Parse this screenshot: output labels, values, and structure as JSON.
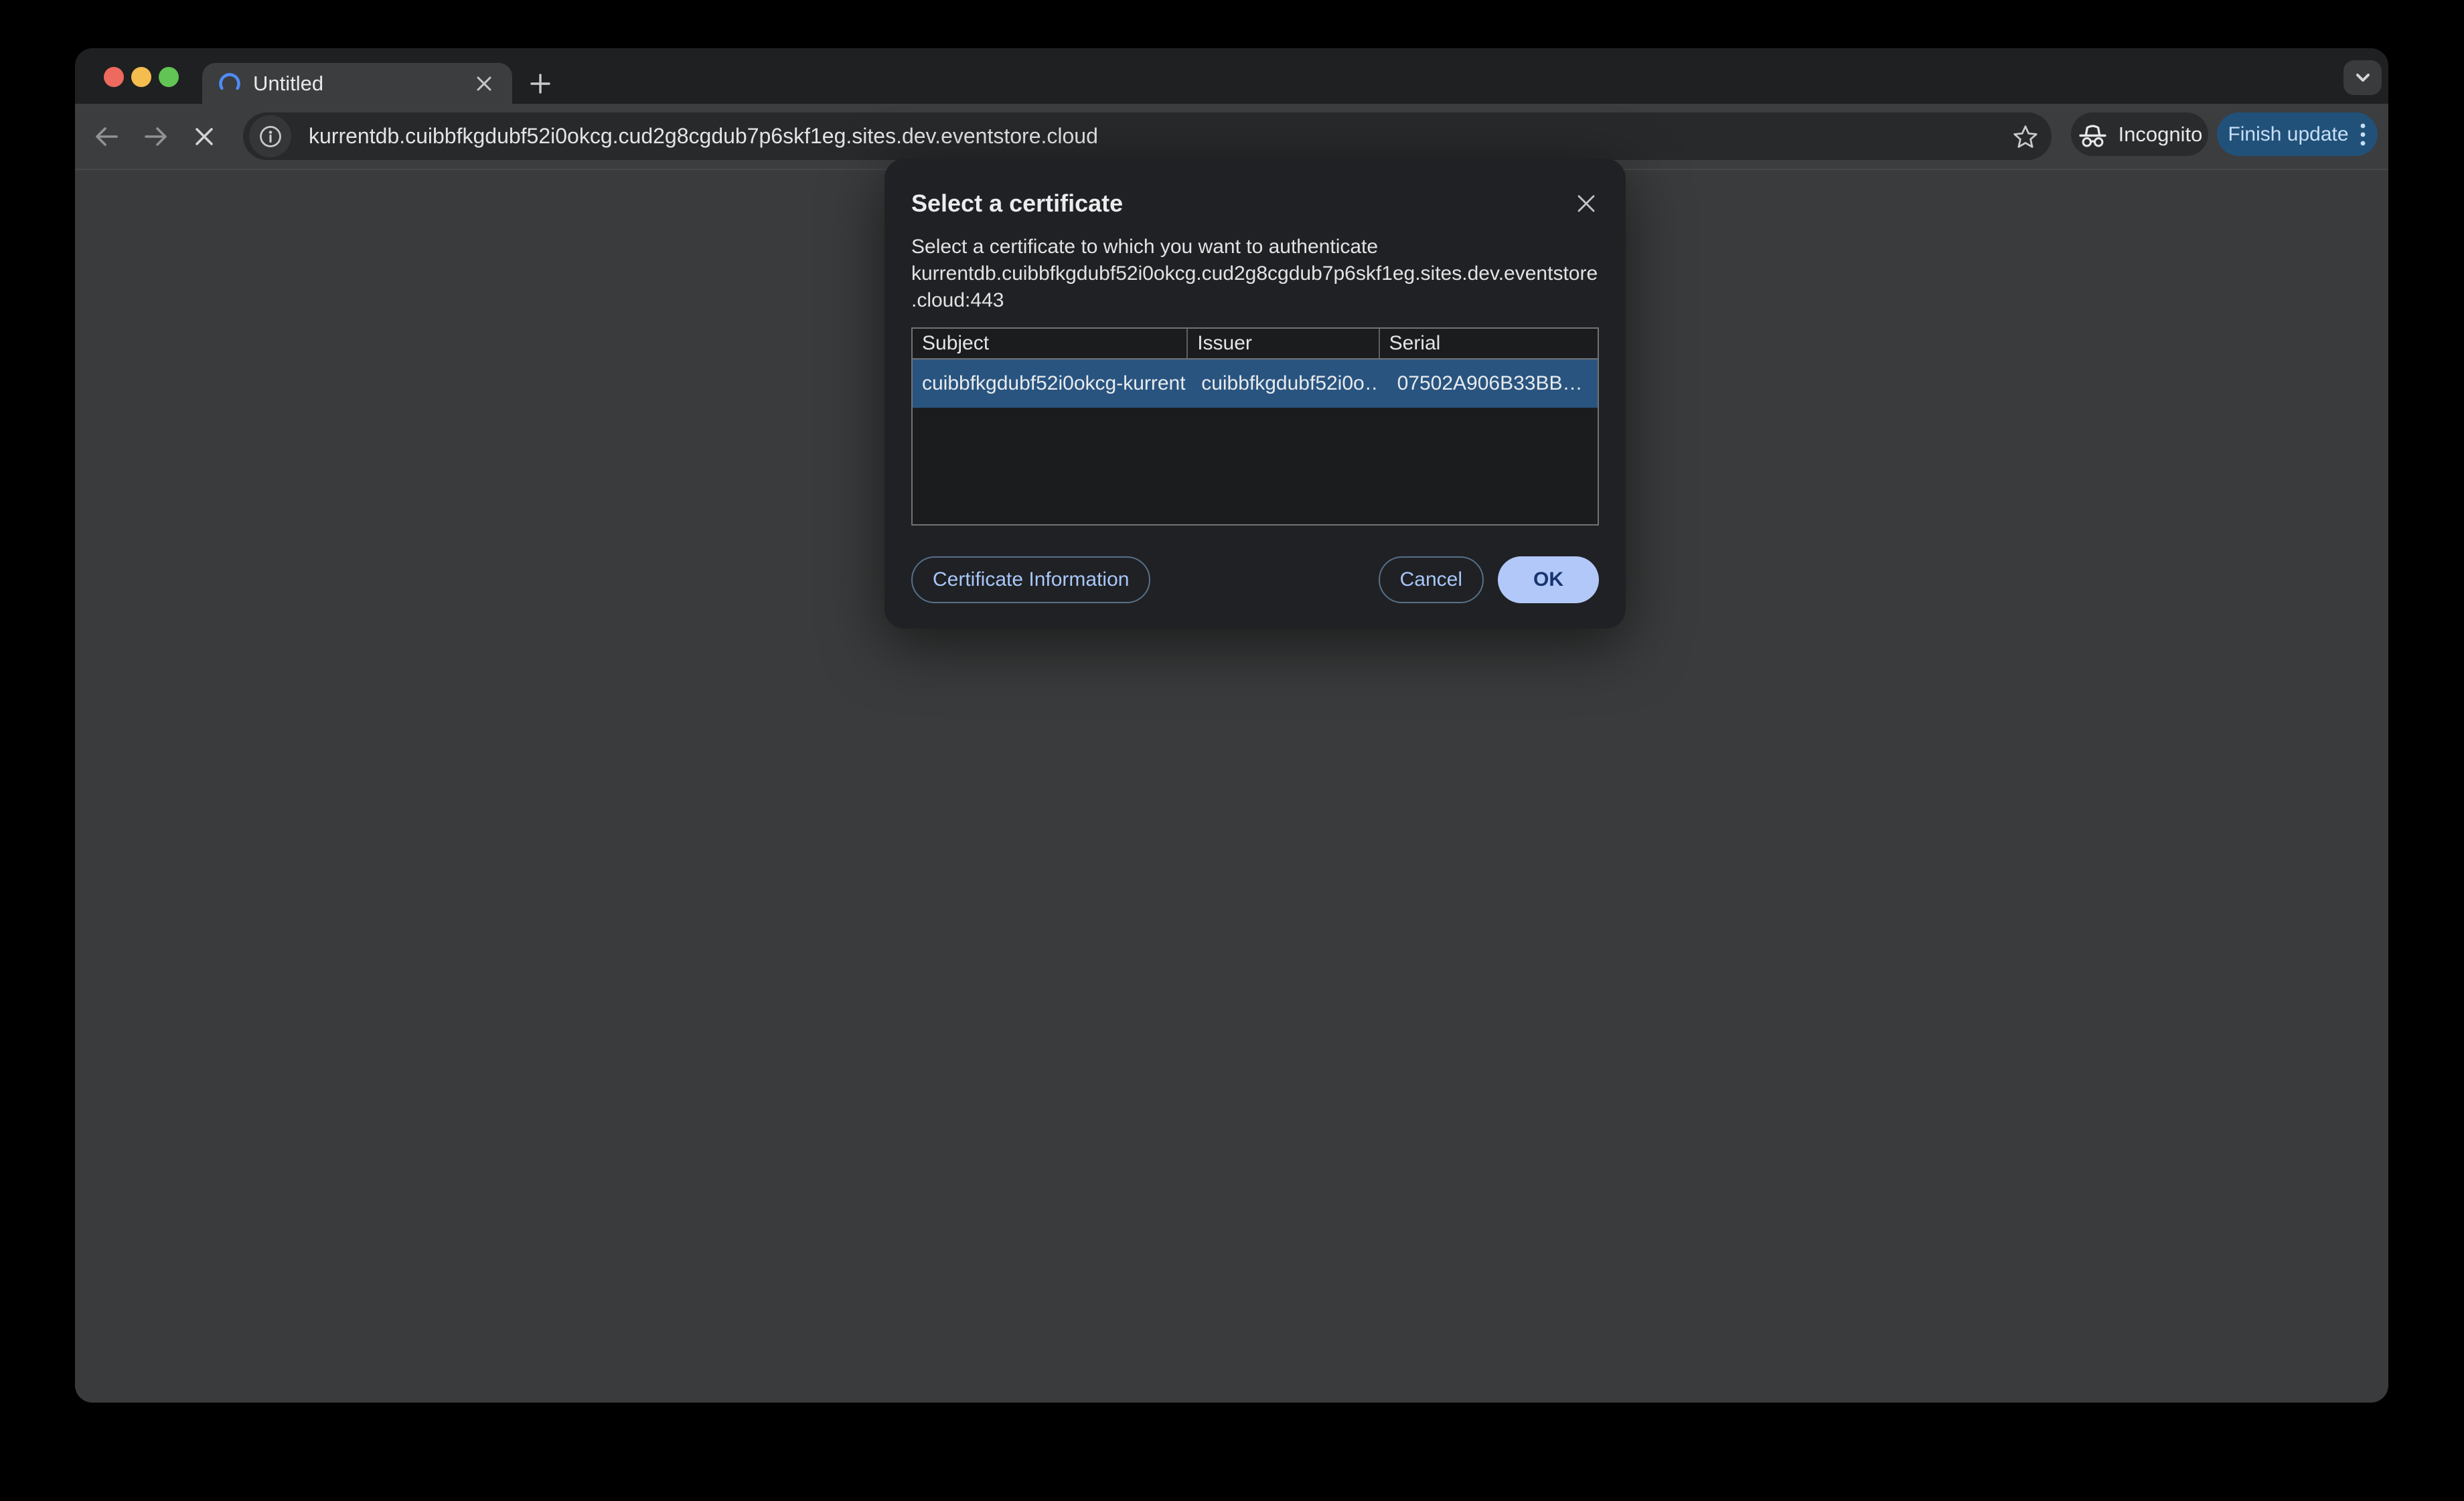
{
  "window": {
    "traffic_lights": [
      "close",
      "minimize",
      "zoom"
    ]
  },
  "tab_strip": {
    "tab": {
      "title": "Untitled",
      "loading": true
    },
    "new_tab_tooltip": "New tab"
  },
  "toolbar": {
    "url": "kurrentdb.cuibbfkgdubf52i0okcg.cud2g8cgdub7p6skf1eg.sites.dev.eventstore.cloud",
    "incognito_label": "Incognito",
    "update_button_label": "Finish update"
  },
  "dialog": {
    "title": "Select a certificate",
    "description": {
      "intro": "Select a certificate to which you want to authenticate",
      "host": "kurrentdb.cuibbfkgdubf52i0okcg.cud2g8cgdub7p6skf1eg.sites.dev.eventstore.cloud:443"
    },
    "table": {
      "columns": [
        "Subject",
        "Issuer",
        "Serial"
      ],
      "rows": [
        {
          "subject": "cuibbfkgdubf52i0okcg-kurrent…",
          "issuer": "cuibbfkgdubf52i0o…",
          "serial": "07502A906B33BB…",
          "selected": true
        }
      ]
    },
    "buttons": {
      "certificate_information": "Certificate Information",
      "cancel": "Cancel",
      "ok": "OK"
    }
  },
  "icons": {
    "tab_loading": "spinner-arc",
    "tab_close": "close",
    "new_tab": "plus",
    "window_menu": "chevron-down",
    "nav_back": "arrow-left",
    "nav_forward": "arrow-right",
    "nav_stop": "close",
    "site_info": "info-circle",
    "bookmark": "star-outline",
    "incognito": "incognito-hat-glasses",
    "browser_menu": "kebab-dots",
    "dialog_close": "close"
  },
  "colors": {
    "traffic_red": "#ee6a5e",
    "traffic_yellow": "#f5bd4f",
    "traffic_green": "#61c454",
    "spinner_blue": "#4e8cf7",
    "selected_row": "#295480",
    "update_button_bg": "#215179",
    "update_button_text": "#c8dff7",
    "outlined_button_text": "#a8c7fa",
    "ok_button_bg": "#b2c8f8",
    "ok_button_text": "#17356f"
  }
}
